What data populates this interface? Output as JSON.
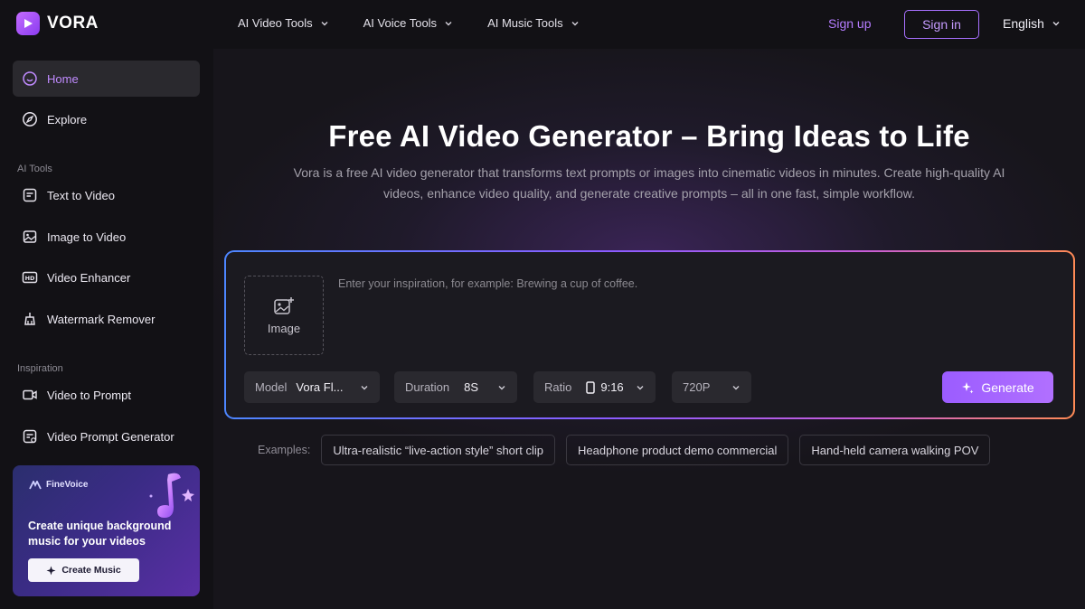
{
  "brand": {
    "name": "VORA"
  },
  "nav": [
    {
      "label": "AI Video Tools"
    },
    {
      "label": "AI Voice Tools"
    },
    {
      "label": "AI Music Tools"
    }
  ],
  "auth": {
    "signup": "Sign up",
    "signin": "Sign in"
  },
  "language": "English",
  "sidebar": {
    "top": [
      {
        "label": "Home",
        "icon": "home-icon",
        "active": true
      },
      {
        "label": "Explore",
        "icon": "compass-icon"
      }
    ],
    "sections": [
      {
        "title": "AI Tools",
        "items": [
          {
            "label": "Text to Video",
            "icon": "text-document-icon"
          },
          {
            "label": "Image to Video",
            "icon": "image-icon"
          },
          {
            "label": "Video Enhancer",
            "icon": "hd-icon"
          },
          {
            "label": "Watermark Remover",
            "icon": "eraser-icon"
          }
        ]
      },
      {
        "title": "Inspiration",
        "items": [
          {
            "label": "Video to Prompt",
            "icon": "video-camera-icon"
          },
          {
            "label": "Video Prompt Generator",
            "icon": "prompt-document-icon"
          }
        ]
      }
    ],
    "promo": {
      "brand": "FineVoice",
      "title": "Create unique background music for your videos",
      "button": "Create Music"
    }
  },
  "hero": {
    "title": "Free AI Video Generator – Bring Ideas to Life",
    "subtitle": "Vora is a free AI video generator that transforms text prompts or images into cinematic videos in minutes. Create high-quality AI videos, enhance video quality, and generate creative prompts – all in one fast, simple workflow."
  },
  "composer": {
    "image_label": "Image",
    "placeholder": "Enter your inspiration, for example: Brewing a cup of coffee.",
    "controls": {
      "model": {
        "label": "Model",
        "value": "Vora Fl..."
      },
      "duration": {
        "label": "Duration",
        "value": "8S"
      },
      "ratio": {
        "label": "Ratio",
        "value": "9:16"
      },
      "resolution": {
        "value": "720P"
      }
    },
    "generate": "Generate"
  },
  "examples": {
    "label": "Examples:",
    "items": [
      "Ultra-realistic “live-action style” short clip",
      "Headphone product demo commercial",
      "Hand-held camera walking POV"
    ]
  },
  "colors": {
    "accent": "#a870ff",
    "background": "#121115",
    "panel": "#1b1a20"
  }
}
